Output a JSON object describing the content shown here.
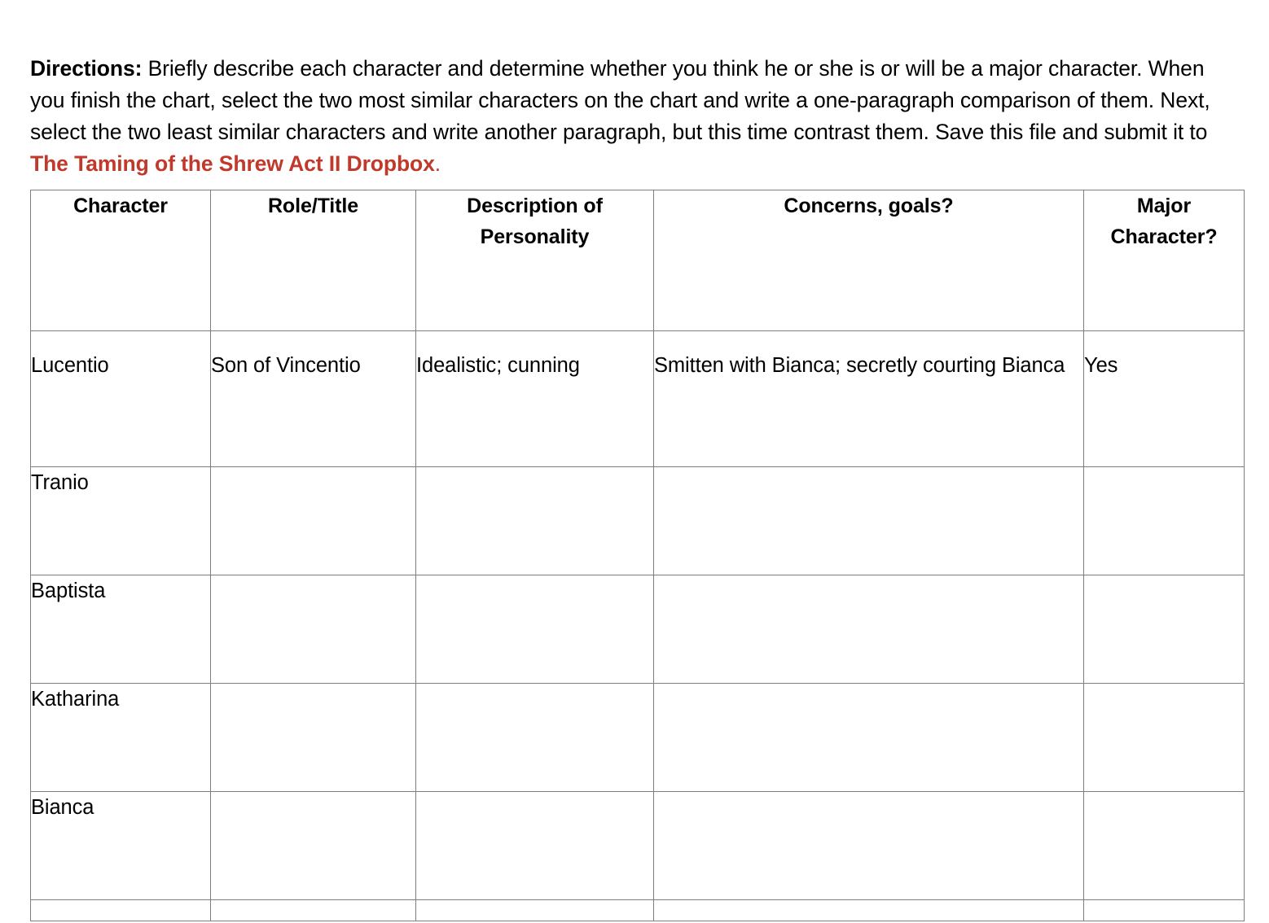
{
  "directions": {
    "label": "Directions:",
    "body": "  Briefly describe each character and determine whether you think he or she is or will be a major character. When you finish the chart, select the two most similar characters on the chart and write a one-paragraph comparison of them. Next, select the two least similar characters and write another paragraph, but this time contrast them. Save this file and submit it to ",
    "dropbox_link": "The Taming of the Shrew Act II Dropbox",
    "trailing_punctuation": ".",
    "link_color": "#C0392B"
  },
  "chart": {
    "columns": [
      {
        "key": "character",
        "label": "Character"
      },
      {
        "key": "role",
        "label": "Role/Title"
      },
      {
        "key": "personality",
        "label": "Description of\nPersonality"
      },
      {
        "key": "concerns",
        "label": "Concerns, goals?"
      },
      {
        "key": "major",
        "label": "Major\nCharacter?"
      }
    ],
    "rows": [
      {
        "character": "Lucentio",
        "role": "Son of Vincentio",
        "personality": "Idealistic; cunning",
        "concerns": "Smitten with Bianca; secretly courting Bianca",
        "major": "Yes"
      },
      {
        "character": "Tranio",
        "role": "",
        "personality": "",
        "concerns": "",
        "major": ""
      },
      {
        "character": "Baptista",
        "role": "",
        "personality": "",
        "concerns": "",
        "major": ""
      },
      {
        "character": "Katharina",
        "role": "",
        "personality": "",
        "concerns": "",
        "major": ""
      },
      {
        "character": "Bianca",
        "role": "",
        "personality": "",
        "concerns": "",
        "major": ""
      },
      {
        "character": "",
        "role": "",
        "personality": "",
        "concerns": "",
        "major": ""
      }
    ]
  }
}
